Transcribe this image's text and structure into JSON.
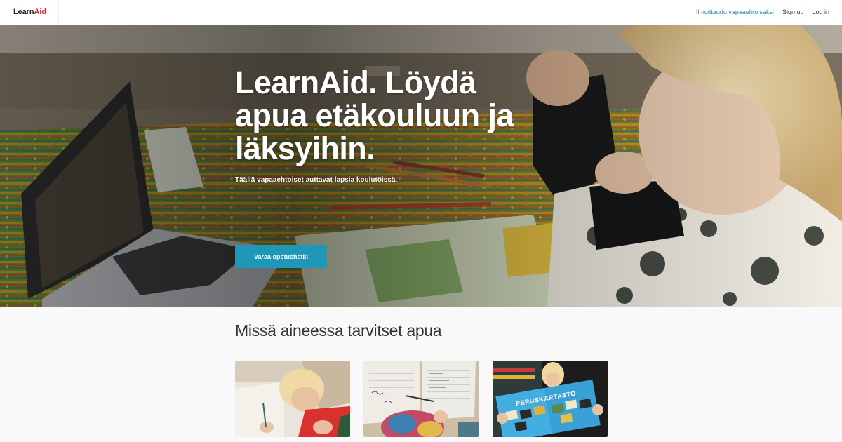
{
  "header": {
    "logo": {
      "part1": "Learn",
      "part2": "Aid"
    },
    "nav": {
      "volunteer": "Ilmoittaudu vapaaehtoiseksi",
      "signup": "Sign up",
      "login": "Log in"
    }
  },
  "hero": {
    "title": "LearnAid. Löydä apua etäkouluun ja läksyihin.",
    "subtitle": "Täällä vapaaehtoiset auttavat lapsia koulutöissä.",
    "cta": "Varaa opetushetki"
  },
  "subjects": {
    "title": "Missä aineessa tarvitset apua",
    "cards": [
      {
        "image": "child-writing-photo"
      },
      {
        "image": "notebook-homework-photo"
      },
      {
        "image": "child-reading-atlas-photo",
        "book_title": "PERUSKARTASTO"
      }
    ]
  },
  "colors": {
    "accent": "#1f97b8",
    "link": "#1b86b7",
    "logo_red": "#e11d2a"
  }
}
